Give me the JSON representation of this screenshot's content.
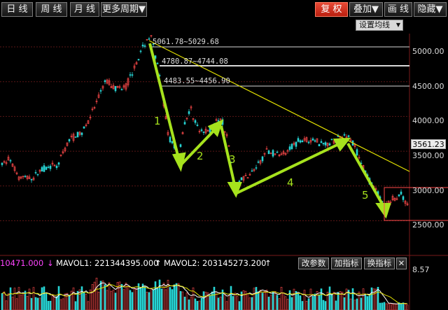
{
  "toolbar": {
    "tabs": [
      {
        "label": "日 线",
        "active": true
      },
      {
        "label": "周 线",
        "active": false
      },
      {
        "label": "月 线",
        "active": false
      }
    ],
    "more_period": "更多周期▼",
    "restore_right": "复 权",
    "overlay": "叠加▼",
    "draw_line": "画 线",
    "hide": "隐藏▼"
  },
  "ma_setting_label": "设置均线",
  "y_axis": {
    "ticks": [
      "5000.00",
      "4500.00",
      "4000.00",
      "3500.00",
      "3000.00",
      "2500.00"
    ],
    "last_price": "3561.23"
  },
  "annotations": {
    "peak_label": "5061.78~5029.68",
    "level_2": "4780.87~4744.08",
    "level_3": "4483.55~4456.90",
    "waves": [
      "1",
      "2",
      "3",
      "4",
      "5"
    ]
  },
  "volume_bar": {
    "vol_value": "10471.000",
    "vol_arrow": "↓",
    "mavol1_label": "MAVOL1: 221344395.000",
    "mavol1_arrow": "↑",
    "mavol2_label": "MAVOL2: 203145273.200",
    "mavol2_arrow": "↑",
    "btn_params": "改参数",
    "btn_add": "加指标",
    "btn_switch": "换指标",
    "btn_close": "✕",
    "axis_value": "8.57"
  },
  "colors": {
    "up": "#ff4a4a",
    "down": "#27d5d5",
    "trend_line": "#e2e000",
    "wave_arrow": "#a6e21d",
    "level_line": "#d8d8d8",
    "highlight_box": "#ff4a4a"
  }
}
